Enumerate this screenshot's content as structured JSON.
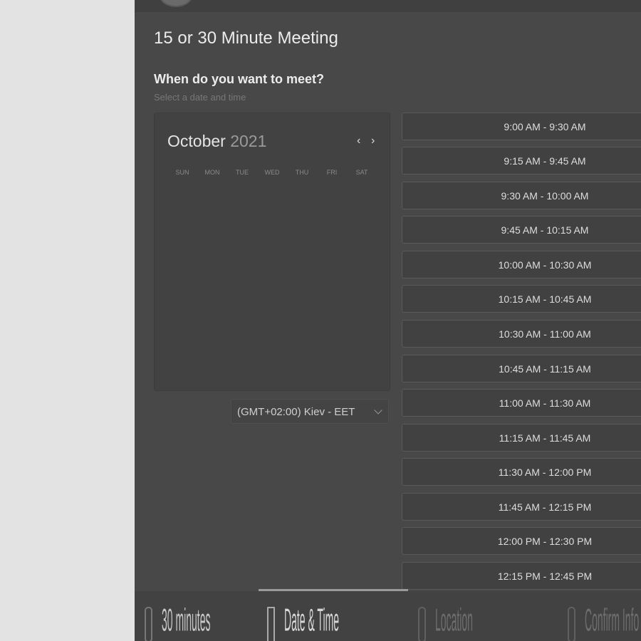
{
  "event": {
    "title": "15 or 30 Minute Meeting",
    "question": "When do you want to meet?",
    "subtitle": "Select a date and time"
  },
  "calendar": {
    "month": "October",
    "year": "2021",
    "prev_icon": "chevron-left-icon",
    "next_icon": "chevron-right-icon",
    "weekdays": [
      "SUN",
      "MON",
      "TUE",
      "WED",
      "THU",
      "FRI",
      "SAT"
    ]
  },
  "timezone": {
    "value": "(GMT+02:00) Kiev - EET",
    "icon": "chevron-down-icon"
  },
  "slots": [
    "9:00 AM - 9:30 AM",
    "9:15 AM - 9:45 AM",
    "9:30 AM - 10:00 AM",
    "9:45 AM - 10:15 AM",
    "10:00 AM - 10:30 AM",
    "10:15 AM - 10:45 AM",
    "10:30 AM - 11:00 AM",
    "10:45 AM - 11:15 AM",
    "11:00 AM - 11:30 AM",
    "11:15 AM - 11:45 AM",
    "11:30 AM - 12:00 PM",
    "11:45 AM - 12:15 PM",
    "12:00 PM - 12:30 PM",
    "12:15 PM - 12:45 PM"
  ],
  "steps": [
    {
      "label": "30 minutes",
      "icon": "clock-icon",
      "state": "done"
    },
    {
      "label": "Date & Time",
      "icon": "calendar-icon",
      "state": "active"
    },
    {
      "label": "Location",
      "icon": "location-pin-icon",
      "state": "pending"
    },
    {
      "label": "Confirm Info",
      "icon": "user-info-icon",
      "state": "pending"
    }
  ],
  "colors": {
    "panel_bg": "#484848",
    "page_bg": "#e3e3e3",
    "slot_border": "#5a5a5a",
    "text": "#dedede"
  }
}
